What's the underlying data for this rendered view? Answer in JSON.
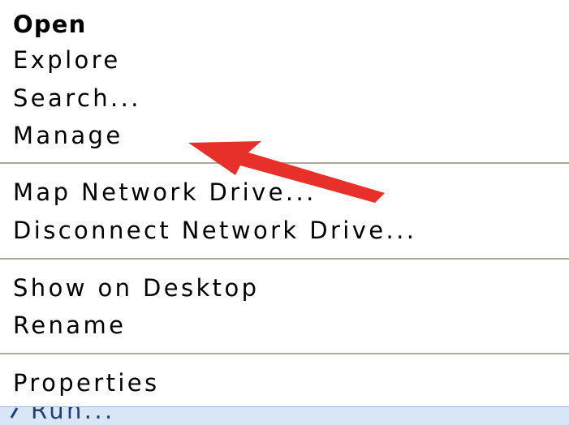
{
  "context_menu": {
    "items": [
      {
        "label": "Open",
        "default": true
      },
      {
        "label": "Explore"
      },
      {
        "label": "Search..."
      },
      {
        "label": "Manage"
      },
      {
        "label": "Map Network Drive..."
      },
      {
        "label": "Disconnect Network Drive..."
      },
      {
        "label": "Show on Desktop"
      },
      {
        "label": "Rename"
      },
      {
        "label": "Properties"
      }
    ]
  },
  "start_menu_behind": {
    "run_label": "Run..."
  },
  "annotation": {
    "arrow_color": "#e8302a",
    "points_to": "Manage"
  }
}
